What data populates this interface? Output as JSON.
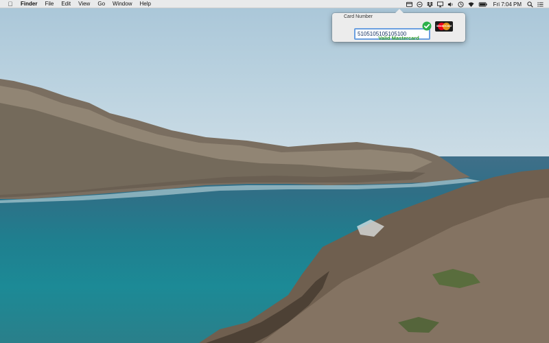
{
  "menubar": {
    "apple_icon": "apple-logo-icon",
    "app_name": "Finder",
    "menus": [
      "File",
      "Edit",
      "View",
      "Go",
      "Window",
      "Help"
    ],
    "tray_icons": [
      "card-validator-icon",
      "sync-icon",
      "dropbox-icon",
      "airplay-icon",
      "volume-icon",
      "time-machine-icon",
      "wifi-icon",
      "battery-icon"
    ],
    "clock": "Fri 7:04 PM",
    "search_icon": "spotlight-search-icon",
    "list_icon": "notification-center-icon"
  },
  "popover": {
    "label": "Card Number",
    "card_number": "5105105105105100",
    "valid_icon": "green-check-icon",
    "brand_logo": "mastercard-logo",
    "brand_logo_text": "MasterCard",
    "status": "Valid Mastercard",
    "status_color": "#2a9a2a"
  },
  "colors": {
    "menubar_bg": "#ececec",
    "input_border": "#6a9fe0",
    "check_green": "#2bb04a",
    "mastercard_red": "#eb001b",
    "mastercard_orange": "#f79e1b"
  }
}
